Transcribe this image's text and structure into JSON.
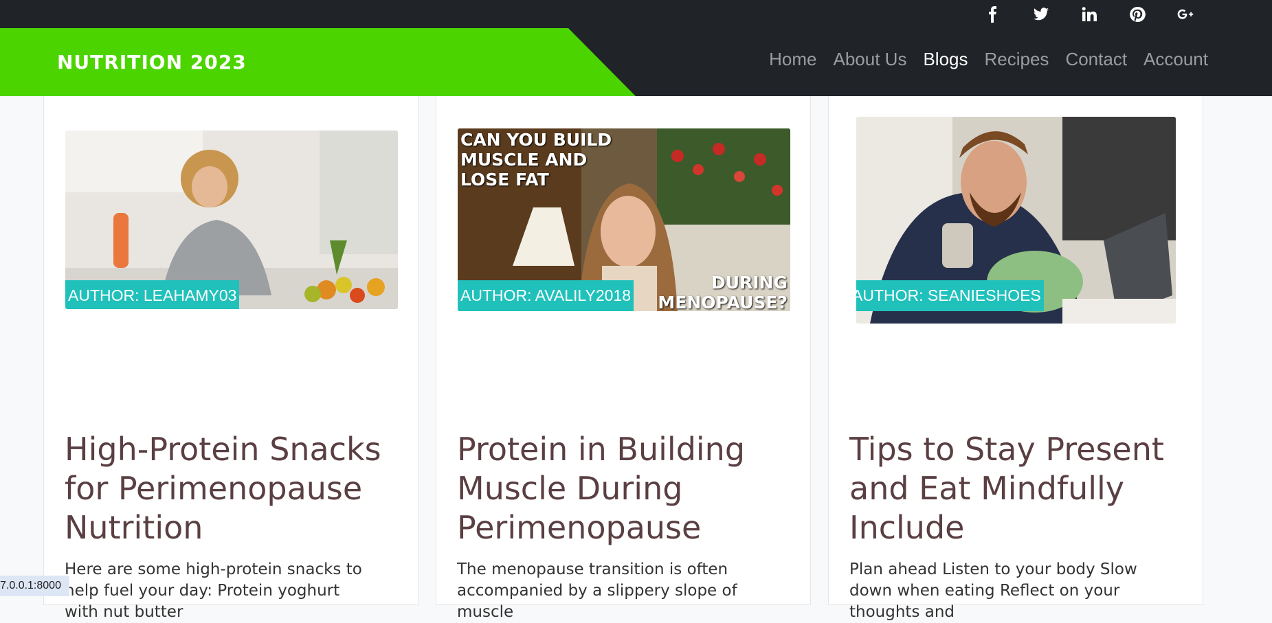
{
  "topbar": {
    "social": [
      {
        "icon": "facebook-icon"
      },
      {
        "icon": "twitter-icon"
      },
      {
        "icon": "linkedin-icon"
      },
      {
        "icon": "pinterest-icon"
      },
      {
        "icon": "google-plus-icon"
      }
    ]
  },
  "header": {
    "brand": "NUTRITION 2023",
    "brand_color": "#4cd400",
    "nav": [
      "Home",
      "About Us",
      "Blogs",
      "Recipes",
      "Contact",
      "Account"
    ],
    "active_nav": "Blogs"
  },
  "cards": [
    {
      "author": "AUTHOR: LEAHAMY03",
      "title": "High-Protein Snacks for Perimenopause Nutrition",
      "excerpt": "Here are some high-protein snacks to help fuel your day: Protein yoghurt with nut butter"
    },
    {
      "author": "AUTHOR: AVALILY2018",
      "title": "Protein in Building Muscle During Perimenopause",
      "excerpt": "The menopause transition is often accompanied by a slippery slope of muscle",
      "image_text_top": "CAN YOU BUILD MUSCLE AND LOSE FAT",
      "image_text_bottom": "DURING MENOPAUSE?"
    },
    {
      "author": "AUTHOR: SEANIESHOES",
      "title": "Tips to Stay Present and Eat Mindfully Include",
      "excerpt": "Plan ahead Listen to your body Slow down when eating Reflect on your thoughts and"
    }
  ],
  "status_bar": "7.0.0.1:8000",
  "colors": {
    "dark": "#202328",
    "badge": "#20c1bb",
    "title": "#5a3f42"
  }
}
